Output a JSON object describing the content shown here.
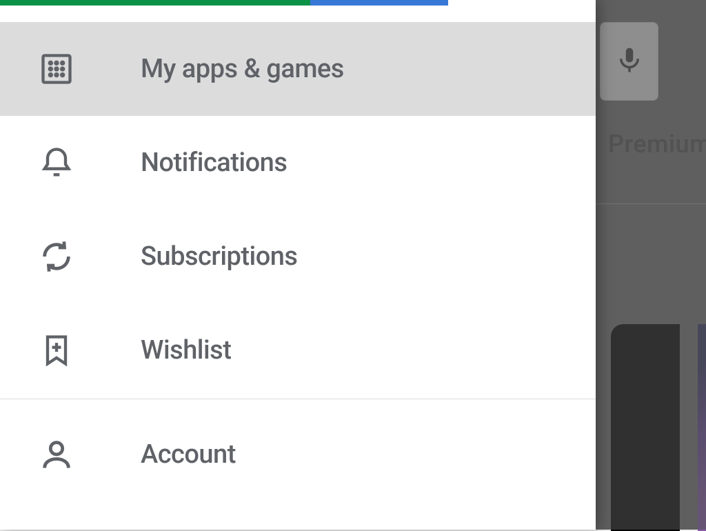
{
  "drawer": {
    "items": [
      {
        "label": "My apps & games",
        "icon": "apps-grid-icon",
        "selected": true
      },
      {
        "label": "Notifications",
        "icon": "bell-icon",
        "selected": false
      },
      {
        "label": "Subscriptions",
        "icon": "refresh-icon",
        "selected": false
      },
      {
        "label": "Wishlist",
        "icon": "bookmark-plus-icon",
        "selected": false
      }
    ],
    "section2": [
      {
        "label": "Account",
        "icon": "person-icon",
        "selected": false
      }
    ]
  },
  "background": {
    "search_icon": "microphone-icon",
    "tab_label": "Premium"
  },
  "colors": {
    "top_bar_green": "#0b9246",
    "top_bar_blue": "#3778d6",
    "selected_bg": "#dcdcdd",
    "text": "#5f6267"
  }
}
